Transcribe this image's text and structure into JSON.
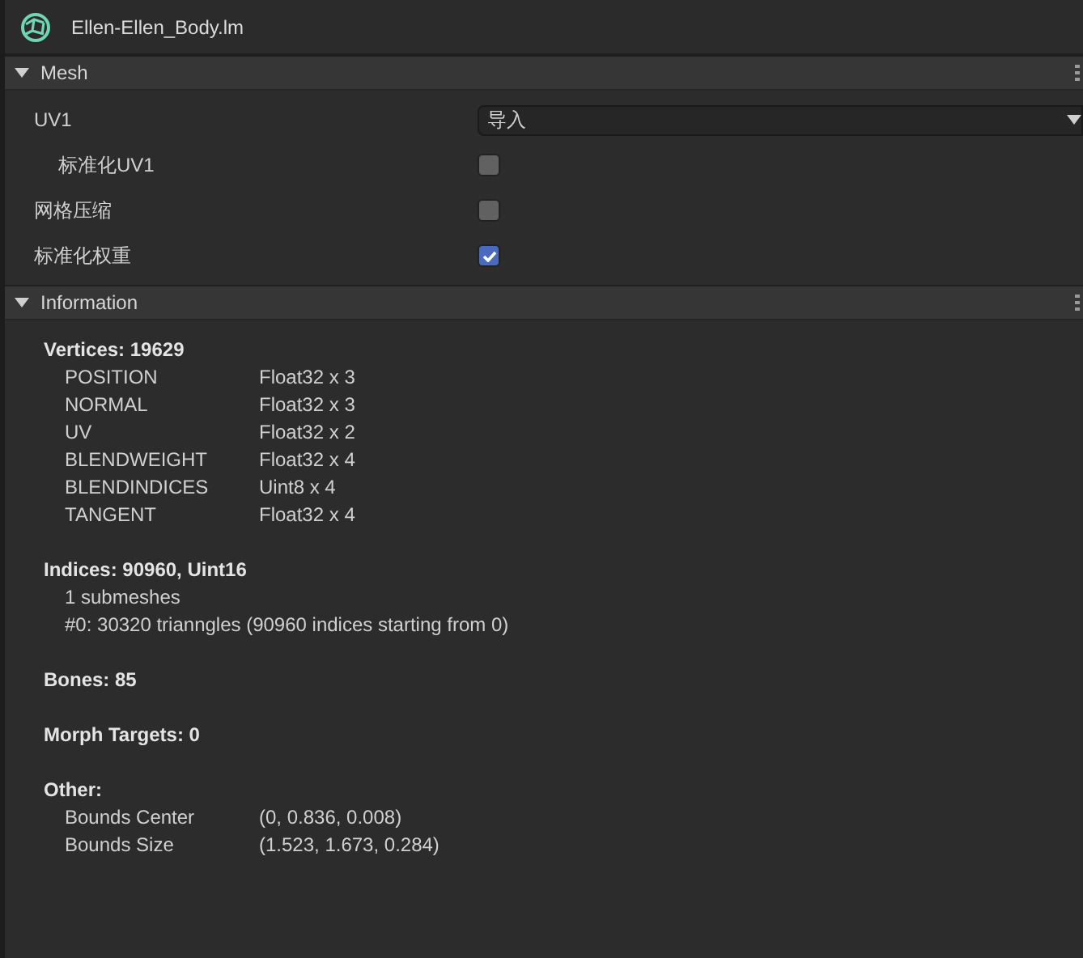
{
  "header": {
    "title": "Ellen-Ellen_Body.lm"
  },
  "sections": [
    {
      "kind": "properties",
      "title": "Mesh",
      "expanded": true,
      "properties": [
        {
          "kind": "dropdown",
          "label": "UV1",
          "value": "导入",
          "indented": false
        },
        {
          "kind": "checkbox",
          "label": "标准化UV1",
          "checked": false,
          "indented": true
        },
        {
          "kind": "checkbox",
          "label": "网格压缩",
          "checked": false,
          "indented": false
        },
        {
          "kind": "checkbox",
          "label": "标准化权重",
          "checked": true,
          "indented": false
        }
      ]
    },
    {
      "kind": "info",
      "title": "Information",
      "expanded": true,
      "groups": [
        {
          "heading": "Vertices: 19629",
          "lines": [
            {
              "kind": "pair",
              "name": "POSITION",
              "value": "Float32 x 3"
            },
            {
              "kind": "pair",
              "name": "NORMAL",
              "value": "Float32 x 3"
            },
            {
              "kind": "pair",
              "name": "UV",
              "value": "Float32 x 2"
            },
            {
              "kind": "pair",
              "name": "BLENDWEIGHT",
              "value": "Float32 x 4"
            },
            {
              "kind": "pair",
              "name": "BLENDINDICES",
              "value": "Uint8 x 4"
            },
            {
              "kind": "pair",
              "name": "TANGENT",
              "value": "Float32 x 4"
            }
          ]
        },
        {
          "heading": "Indices: 90960, Uint16",
          "lines": [
            {
              "kind": "text",
              "text": "1 submeshes"
            },
            {
              "kind": "text",
              "text": "#0: 30320 trianngles (90960 indices starting from 0)"
            }
          ]
        },
        {
          "heading": "Bones: 85"
        },
        {
          "heading": "Morph Targets: 0"
        },
        {
          "heading": "Other:",
          "lines": [
            {
              "kind": "pair",
              "name": "Bounds Center",
              "value": "(0, 0.836, 0.008)"
            },
            {
              "kind": "pair",
              "name": "Bounds Size",
              "value": "(1.523, 1.673, 0.284)"
            }
          ]
        }
      ]
    }
  ]
}
